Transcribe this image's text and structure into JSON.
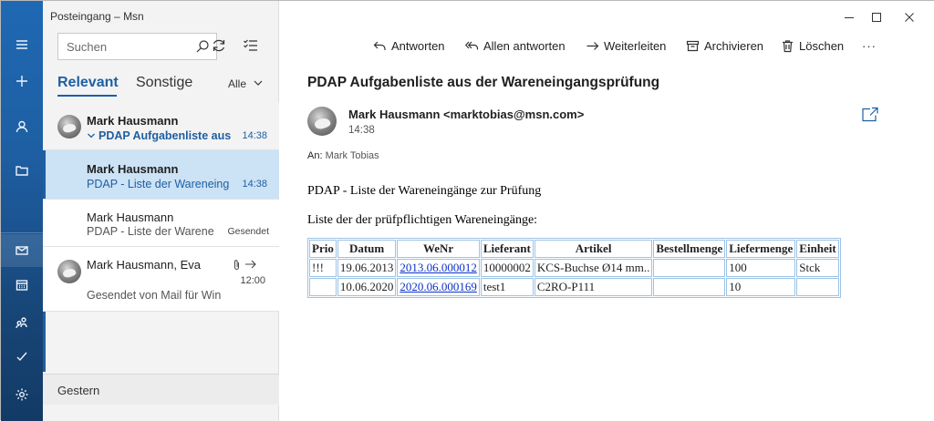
{
  "window": {
    "title": "Posteingang – Msn"
  },
  "search": {
    "placeholder": "Suchen"
  },
  "tabs": {
    "relevant": "Relevant",
    "sonstige": "Sonstige",
    "filter_label": "Alle"
  },
  "messages": [
    {
      "from": "Mark Hausmann",
      "subject": "PDAP Aufgabenliste aus",
      "time": "14:38",
      "has_avatar": true,
      "expanded": true
    },
    {
      "from": "Mark Hausmann",
      "subject": "PDAP - Liste der Wareneing",
      "time": "14:38",
      "selected": true
    },
    {
      "from": "Mark Hausmann",
      "subject": "PDAP - Liste der Warene",
      "time": "Gesendet"
    },
    {
      "from": "Mark Hausmann, Eva",
      "time": "12:00",
      "preview": "Gesendet von Mail für Win",
      "has_avatar": true,
      "icons": [
        "paperclip-icon",
        "forward-icon"
      ]
    }
  ],
  "group_header": "Gestern",
  "toolbar": {
    "reply": "Antworten",
    "reply_all": "Allen antworten",
    "forward": "Weiterleiten",
    "archive": "Archivieren",
    "delete": "Löschen",
    "more": "···"
  },
  "email": {
    "subject": "PDAP Aufgabenliste aus der Wareneingangsprüfung",
    "sender": "Mark Hausmann <marktobias@msn.com>",
    "time": "14:38",
    "to_label": "An:",
    "to_name": "Mark Tobias",
    "body_line1": "PDAP - Liste der Wareneingänge zur Prüfung",
    "body_line2": "Liste der der prüfpflichtigen Wareneingänge:"
  },
  "table": {
    "headers": [
      "Prio",
      "Datum",
      "WeNr",
      "Lieferant",
      "Artikel",
      "Bestellmenge",
      "Liefermenge",
      "Einheit"
    ],
    "rows": [
      [
        "!!!",
        "19.06.2013",
        "2013.06.000012",
        "10000002",
        "KCS-Buchse Ø14 mm..",
        "",
        "100",
        "Stck"
      ],
      [
        "",
        "10.06.2020",
        "2020.06.000169",
        "test1",
        "C2RO-P111",
        "",
        "10",
        ""
      ]
    ]
  },
  "colors": {
    "accent": "#1e5fa3",
    "selected_bg": "#cce2f5",
    "link": "#0b31c9",
    "table_border": "#9dc3e6"
  }
}
